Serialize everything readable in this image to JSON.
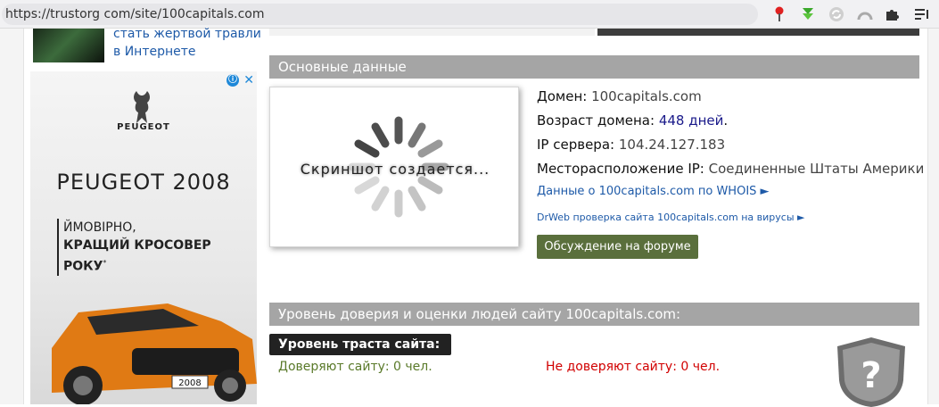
{
  "browser": {
    "url": "https://trustorg com/site/100capitals.com",
    "icons": [
      "pin-icon",
      "download-icon",
      "sync-icon",
      "rainbow-icon",
      "puzzle-icon",
      "list-icon"
    ]
  },
  "teaser": {
    "text": "стать жертвой травли в Интернете"
  },
  "ad": {
    "info_symbol": "ⓘ",
    "close_symbol": "✕",
    "brand": "PEUGEOT",
    "model": "PEUGEOT 2008",
    "copy_line1": "ЙМОВІРНО,",
    "copy_line2": "КРАЩИЙ КРОСОВЕР",
    "copy_line3": "РОКУ",
    "copy_superscript": "*",
    "plate": "2008"
  },
  "main": {
    "section_title": "Основные данные",
    "screenshot_text": "Скриншот создается...",
    "domain_label": "Домен:",
    "domain_value": "100capitals.com",
    "age_label": "Возраст домена:",
    "age_value": "448 дней",
    "age_suffix": ".",
    "ip_label": "IP сервера:",
    "ip_value": "104.24.127.183",
    "location_label": "Месторасположение IP:",
    "location_value": "Соединенные Штаты Америки",
    "whois_link": "Данные о 100capitals.com по WHOIS ►",
    "drweb_link": "DrWeb проверка сайта 100capitals.com на вирусы ►",
    "forum_button": "Обсуждение на форуме"
  },
  "trust": {
    "section_title": "Уровень доверия и оценки людей сайту 100capitals.com:",
    "level_button": "Уровень траста сайта: ?",
    "trust_yes": "Доверяют сайту: 0 чел.",
    "trust_no": "Не доверяют сайту: 0 чел.",
    "shield_symbol": "?"
  },
  "colors": {
    "section_header": "#a5a5a5",
    "link": "#1e5aa8",
    "forum_button": "#5a6f3c",
    "trust_yes": "#5a7a2a",
    "trust_no": "#d10000"
  }
}
